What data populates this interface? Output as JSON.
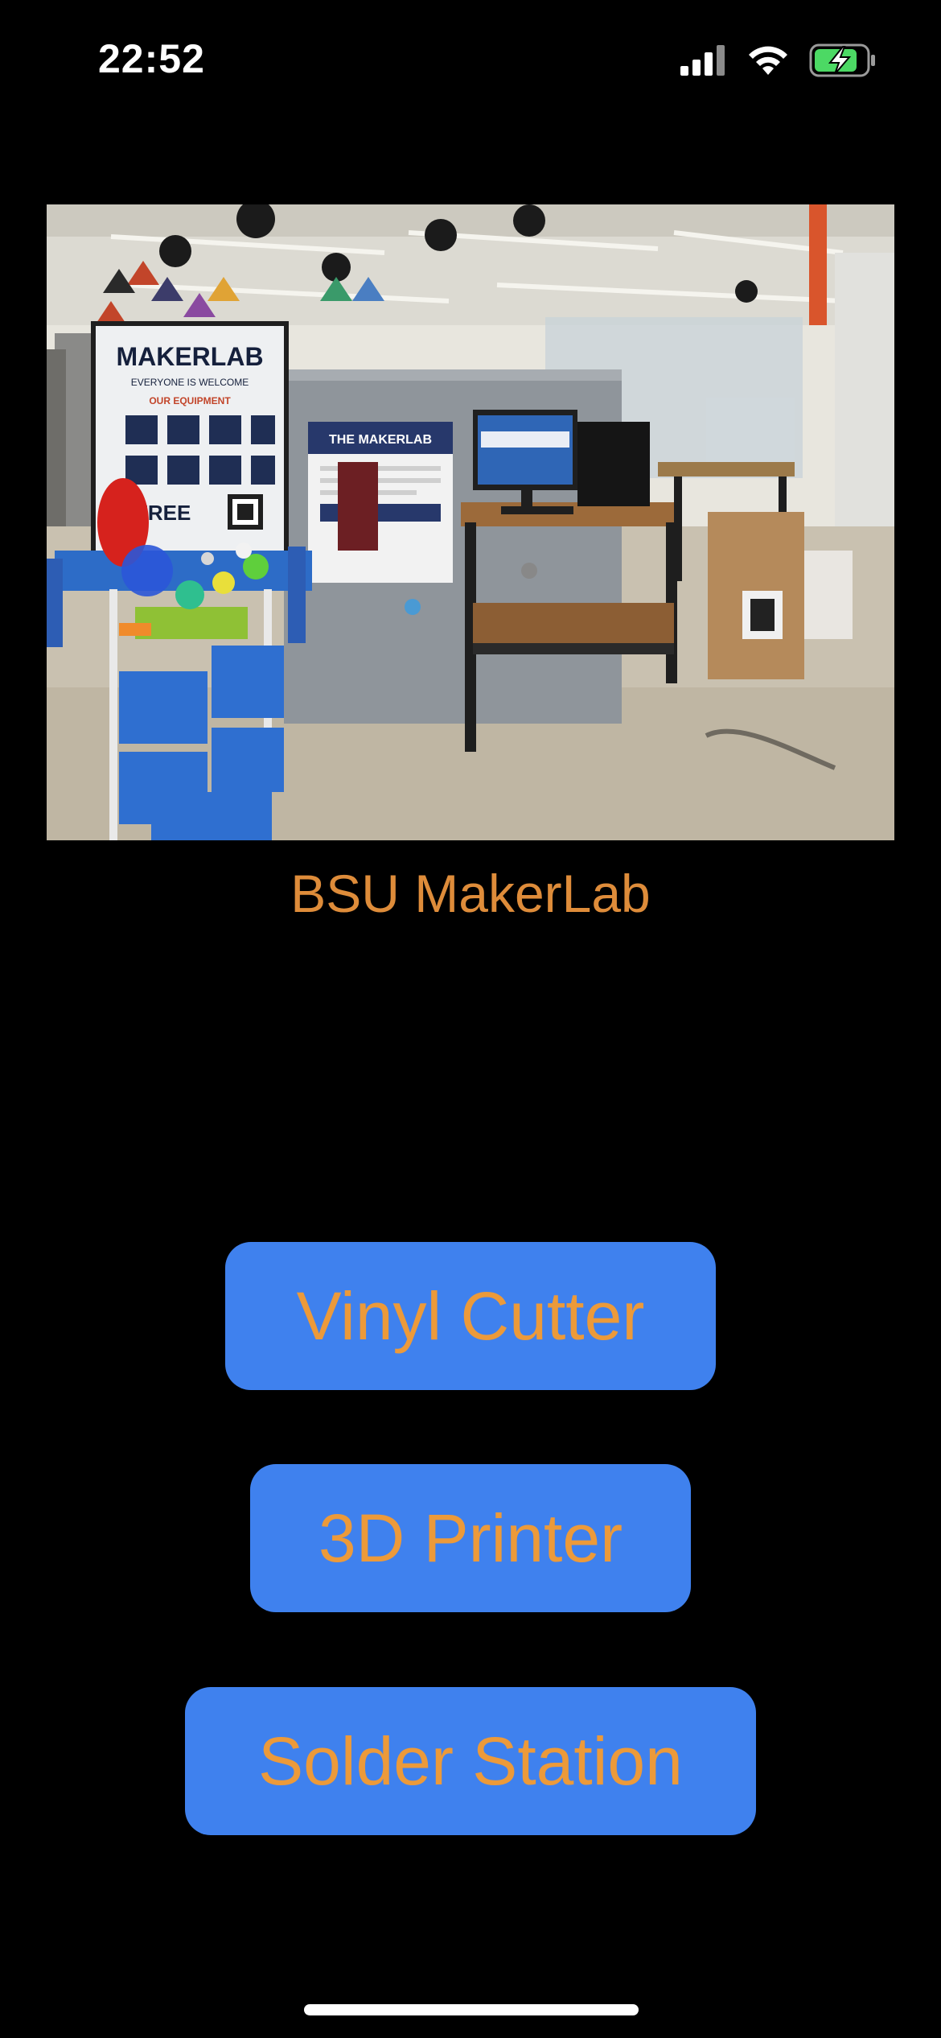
{
  "status_bar": {
    "time": "22:52",
    "icons": [
      "cellular-signal-icon",
      "wifi-icon",
      "battery-charging-icon"
    ],
    "battery_color": "#4cd964"
  },
  "hero": {
    "caption": "BSU MakerLab",
    "poster_title": "MAKERLAB",
    "poster_subtitle": "EVERYONE IS WELCOME",
    "poster_section": "OUR EQUIPMENT",
    "poster_free": "FREE",
    "board_title": "THE MAKERLAB"
  },
  "buttons": {
    "vinyl_cutter": "Vinyl Cutter",
    "printer_3d": "3D Printer",
    "solder_station": "Solder Station"
  },
  "colors": {
    "background": "#000000",
    "button_fill": "#3f81ee",
    "button_text": "#ec9a3a",
    "caption_text": "#de8c3a"
  }
}
